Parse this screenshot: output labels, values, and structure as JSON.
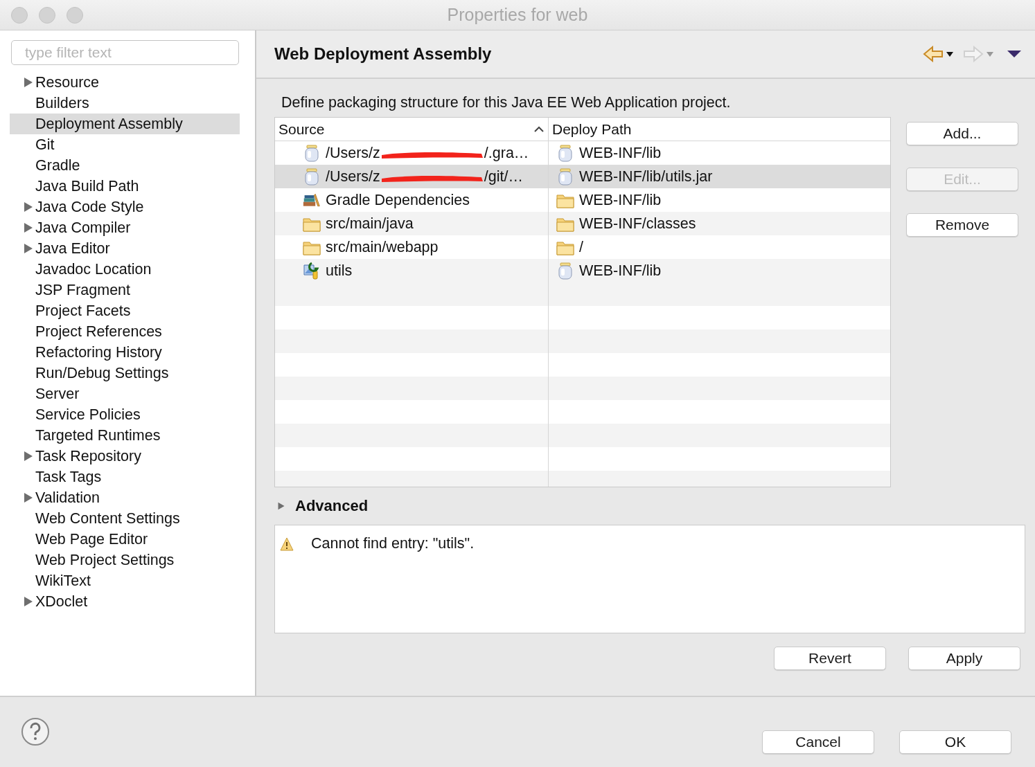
{
  "window": {
    "title": "Properties for web"
  },
  "filter": {
    "placeholder": "type filter text"
  },
  "sidebar": {
    "items": [
      {
        "label": "Resource",
        "kind": "group",
        "expanded": false,
        "selected": false
      },
      {
        "label": "Builders",
        "kind": "page",
        "selected": false
      },
      {
        "label": "Deployment Assembly",
        "kind": "page",
        "selected": true
      },
      {
        "label": "Git",
        "kind": "page",
        "selected": false
      },
      {
        "label": "Gradle",
        "kind": "page",
        "selected": false
      },
      {
        "label": "Java Build Path",
        "kind": "page",
        "selected": false
      },
      {
        "label": "Java Code Style",
        "kind": "group",
        "expanded": false,
        "selected": false
      },
      {
        "label": "Java Compiler",
        "kind": "group",
        "expanded": false,
        "selected": false
      },
      {
        "label": "Java Editor",
        "kind": "group",
        "expanded": false,
        "selected": false
      },
      {
        "label": "Javadoc Location",
        "kind": "page",
        "selected": false
      },
      {
        "label": "JSP Fragment",
        "kind": "page",
        "selected": false
      },
      {
        "label": "Project Facets",
        "kind": "page",
        "selected": false
      },
      {
        "label": "Project References",
        "kind": "page",
        "selected": false
      },
      {
        "label": "Refactoring History",
        "kind": "page",
        "selected": false
      },
      {
        "label": "Run/Debug Settings",
        "kind": "page",
        "selected": false
      },
      {
        "label": "Server",
        "kind": "page",
        "selected": false
      },
      {
        "label": "Service Policies",
        "kind": "page",
        "selected": false
      },
      {
        "label": "Targeted Runtimes",
        "kind": "page",
        "selected": false
      },
      {
        "label": "Task Repository",
        "kind": "group",
        "expanded": false,
        "selected": false
      },
      {
        "label": "Task Tags",
        "kind": "page",
        "selected": false
      },
      {
        "label": "Validation",
        "kind": "group",
        "expanded": false,
        "selected": false
      },
      {
        "label": "Web Content Settings",
        "kind": "page",
        "selected": false
      },
      {
        "label": "Web Page Editor",
        "kind": "page",
        "selected": false
      },
      {
        "label": "Web Project Settings",
        "kind": "page",
        "selected": false
      },
      {
        "label": "WikiText",
        "kind": "page",
        "selected": false
      },
      {
        "label": "XDoclet",
        "kind": "group",
        "expanded": false,
        "selected": false
      }
    ]
  },
  "page": {
    "title": "Web Deployment Assembly",
    "nav": [
      {
        "kind": "back",
        "disabled": false
      },
      {
        "kind": "forward",
        "disabled": true
      },
      {
        "kind": "menu",
        "disabled": false
      }
    ],
    "description": "Define packaging structure for this Java EE Web Application project.",
    "table": {
      "columns": [
        {
          "label": "Source",
          "sorted": true
        },
        {
          "label": "Deploy Path",
          "sorted": false
        }
      ],
      "rows": [
        {
          "selected": false,
          "source": {
            "kind": "jar",
            "text": "/Users/z",
            "redacted": true,
            "text_end": "/.gra…"
          },
          "deploy": {
            "kind": "jar",
            "text": "WEB-INF/lib"
          }
        },
        {
          "selected": true,
          "source": {
            "kind": "jar",
            "text": "/Users/z",
            "redacted": true,
            "text_end": "/git/…"
          },
          "deploy": {
            "kind": "jar",
            "text": "WEB-INF/lib/utils.jar"
          }
        },
        {
          "selected": false,
          "source": {
            "kind": "library",
            "text": "Gradle Dependencies",
            "redacted": false
          },
          "deploy": {
            "kind": "folder",
            "text": "WEB-INF/lib"
          }
        },
        {
          "selected": false,
          "source": {
            "kind": "folder",
            "text": "src/main/java",
            "redacted": false
          },
          "deploy": {
            "kind": "folder",
            "text": "WEB-INF/classes"
          }
        },
        {
          "selected": false,
          "source": {
            "kind": "folder",
            "text": "src/main/webapp",
            "redacted": false
          },
          "deploy": {
            "kind": "folder",
            "text": "/"
          }
        },
        {
          "selected": false,
          "source": {
            "kind": "project",
            "text": "utils",
            "redacted": false
          },
          "deploy": {
            "kind": "jar",
            "text": "WEB-INF/lib"
          }
        }
      ]
    },
    "side_buttons": [
      {
        "label": "Add...",
        "disabled": false
      },
      {
        "label": "Edit...",
        "disabled": true
      },
      {
        "label": "Remove",
        "disabled": false
      }
    ],
    "advanced": {
      "label": "Advanced",
      "expanded": false
    },
    "messages": [
      {
        "kind": "warning",
        "text": "Cannot find entry: \"utils\"."
      }
    ],
    "buttons": [
      {
        "label": "Revert",
        "disabled": false
      },
      {
        "label": "Apply",
        "disabled": false
      }
    ]
  },
  "footer": {
    "buttons": [
      {
        "label": "Cancel",
        "disabled": false
      },
      {
        "label": "OK",
        "disabled": false
      }
    ]
  }
}
